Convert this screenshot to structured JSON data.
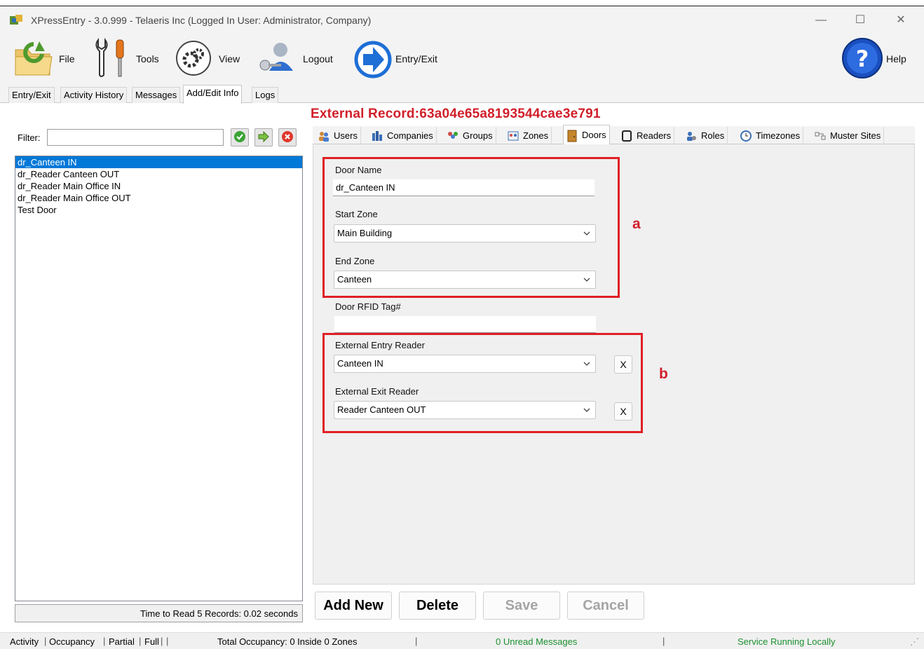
{
  "window": {
    "title": "XPressEntry - 3.0.999 - Telaeris Inc (Logged In User: Administrator, Company)",
    "minimize": "—",
    "maximize": "☐",
    "close": "✕"
  },
  "toolbar": {
    "file": "File",
    "tools": "Tools",
    "view": "View",
    "logout": "Logout",
    "entry_exit": "Entry/Exit",
    "help": "Help"
  },
  "main_tabs": [
    "Entry/Exit",
    "Activity History",
    "Messages",
    "Add/Edit Info",
    "Logs"
  ],
  "record_heading": "External Record:63a04e65a8193544cae3e791",
  "left": {
    "filter_label": "Filter:",
    "filter_value": "",
    "items": [
      "dr_Canteen IN",
      "dr_Reader Canteen OUT",
      "dr_Reader Main Office IN",
      "dr_Reader Main Office OUT",
      "Test Door"
    ],
    "status": "Time to Read 5 Records: 0.02 seconds"
  },
  "sub_tabs": [
    "Users",
    "Companies",
    "Groups",
    "Zones",
    "Doors",
    "Readers",
    "Roles",
    "Timezones",
    "Muster Sites"
  ],
  "form": {
    "door_name_label": "Door Name",
    "door_name_value": "dr_Canteen IN",
    "start_zone_label": "Start Zone",
    "start_zone_value": "Main Building",
    "end_zone_label": "End Zone",
    "end_zone_value": "Canteen",
    "rfid_label": "Door RFID Tag#",
    "rfid_value": "",
    "entry_reader_label": "External Entry Reader",
    "entry_reader_value": "Canteen IN",
    "exit_reader_label": "External Exit Reader",
    "exit_reader_value": "Reader Canteen OUT",
    "clear_label": "X"
  },
  "annotations": {
    "a": "a",
    "b": "b"
  },
  "actions": {
    "add_new": "Add New",
    "delete": "Delete",
    "save": "Save",
    "cancel": "Cancel"
  },
  "statusbar": {
    "activity": "Activity",
    "occupancy": "Occupancy",
    "partial": "Partial",
    "full": "Full",
    "total": "Total Occupancy: 0 Inside 0 Zones",
    "messages": "0 Unread Messages",
    "service": "Service Running Locally"
  },
  "colors": {
    "accent_red": "#d11f2a",
    "selection_blue": "#0078d7",
    "status_green": "#1a8f2e"
  }
}
